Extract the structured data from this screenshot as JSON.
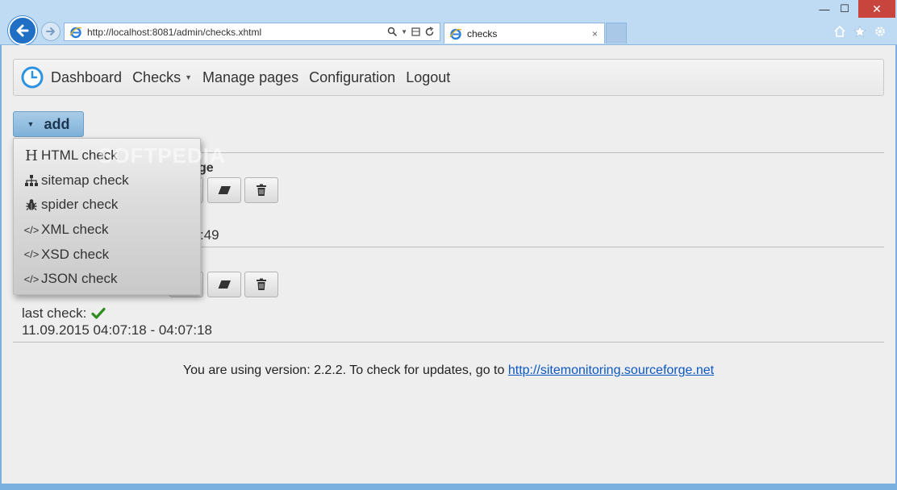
{
  "browser": {
    "url": "http://localhost:8081/admin/checks.xhtml",
    "tab_title": "checks",
    "tab_close": "×",
    "window_min": "—",
    "window_max": "☐",
    "window_close": "✕"
  },
  "navbar": {
    "items": [
      {
        "label": "Dashboard"
      },
      {
        "label": "Checks",
        "has_caret": true
      },
      {
        "label": "Manage pages"
      },
      {
        "label": "Configuration"
      },
      {
        "label": "Logout"
      }
    ],
    "caret": "▼"
  },
  "toolbar": {
    "add_label": "add",
    "add_caret": "▼"
  },
  "dropdown": {
    "items": [
      {
        "icon": "html-header-icon",
        "glyph": "H",
        "label": "HTML check"
      },
      {
        "icon": "sitemap-icon",
        "glyph": "",
        "label": "sitemap check"
      },
      {
        "icon": "bug-icon",
        "glyph": "",
        "label": "spider check"
      },
      {
        "icon": "code-icon",
        "glyph": "</>",
        "label": "XML check"
      },
      {
        "icon": "code-icon",
        "glyph": "</>",
        "label": "XSD check"
      },
      {
        "icon": "code-icon",
        "glyph": "</>",
        "label": "JSON check"
      }
    ],
    "watermark": "SOFTPEDIA"
  },
  "checks": [
    {
      "title_fragment": "ge",
      "time_fragment": ":49"
    },
    {
      "last_check_label": "last check:",
      "last_check_time": "11.09.2015 04:07:18 - 04:07:18"
    }
  ],
  "footer": {
    "version_text": "You are using version: 2.2.2. To check for updates, go to ",
    "link_text": "http://sitemonitoring.sourceforge.net"
  },
  "colors": {
    "accent": "#1f6fc5",
    "add_button": "#8fbde0",
    "link": "#0b58c2",
    "ok_check": "#2e8b1e"
  }
}
